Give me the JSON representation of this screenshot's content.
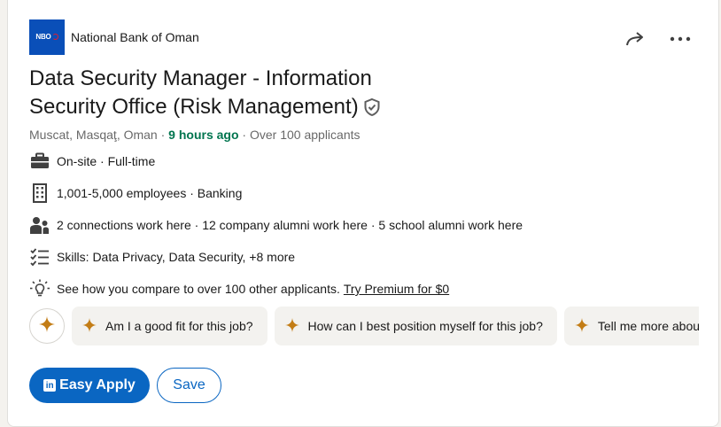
{
  "company": {
    "logo_text": "NBO",
    "name": "National Bank of Oman"
  },
  "job": {
    "title": "Data Security Manager - Information Security Office (Risk Management)",
    "location": "Muscat, Masqaţ, Oman",
    "separator": " · ",
    "posted": "9 hours ago",
    "applicants": "Over 100 applicants"
  },
  "insights": [
    {
      "icon": "briefcase-icon",
      "text": "On-site · Full-time"
    },
    {
      "icon": "building-icon",
      "text": "1,001-5,000 employees · Banking"
    },
    {
      "icon": "people-icon",
      "text": "2 connections work here · 12 company alumni work here · 5 school alumni work here"
    },
    {
      "icon": "checklist-icon",
      "text": "Skills: Data Privacy, Data Security, +8 more"
    },
    {
      "icon": "lightbulb-icon",
      "text": "See how you compare to over 100 other applicants.",
      "link": "Try Premium for $0"
    }
  ],
  "chips": [
    "Am I a good fit for this job?",
    "How can I best position myself for this job?",
    "Tell me more about"
  ],
  "actions": {
    "apply_label": "Easy Apply",
    "apply_icon": "in",
    "save_label": "Save"
  },
  "colors": {
    "primary": "#0a66c2",
    "posted_green": "#01754f",
    "spark": "#c37d16",
    "logo_bg": "#0a4fb8"
  }
}
